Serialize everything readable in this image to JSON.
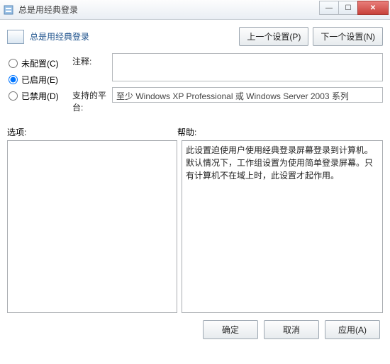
{
  "window": {
    "title": "总是用经典登录"
  },
  "header": {
    "title": "总是用经典登录",
    "prev_button": "上一个设置(P)",
    "next_button": "下一个设置(N)"
  },
  "radios": {
    "not_configured": "未配置(C)",
    "enabled": "已启用(E)",
    "disabled": "已禁用(D)",
    "selected": "enabled"
  },
  "fields": {
    "comment_label": "注释:",
    "comment_value": "",
    "platform_label": "支持的平台:",
    "platform_value": "至少 Windows XP Professional 或 Windows Server 2003 系列"
  },
  "lists": {
    "options_label": "选项:",
    "help_label": "帮助:",
    "help_text": "此设置迫使用户使用经典登录屏幕登录到计算机。默认情况下，工作组设置为使用简单登录屏幕。只有计算机不在域上时，此设置才起作用。"
  },
  "footer": {
    "ok": "确定",
    "cancel": "取消",
    "apply": "应用(A)"
  }
}
